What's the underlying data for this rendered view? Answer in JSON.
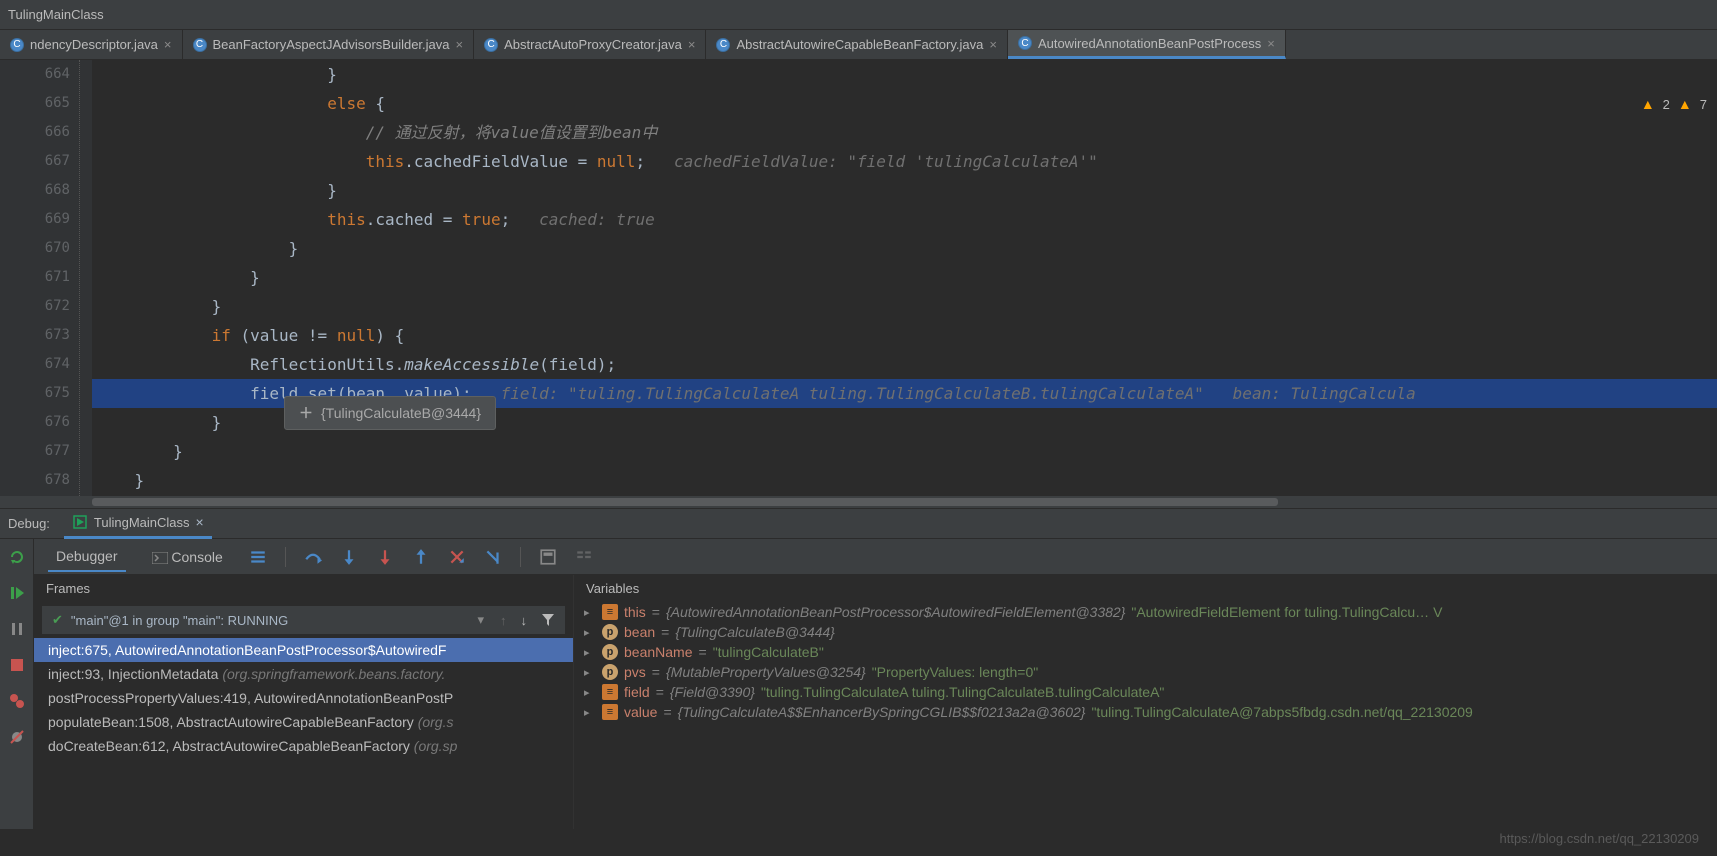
{
  "topbar": {
    "run_config": "TulingMainClass"
  },
  "tabs": [
    {
      "label": "ndencyDescriptor.java",
      "active": false
    },
    {
      "label": "BeanFactoryAspectJAdvisorsBuilder.java",
      "active": false
    },
    {
      "label": "AbstractAutoProxyCreator.java",
      "active": false
    },
    {
      "label": "AbstractAutowireCapableBeanFactory.java",
      "active": false
    },
    {
      "label": "AutowiredAnnotationBeanPostProcess",
      "active": true
    }
  ],
  "warnings": {
    "count1": "2",
    "count2": "7"
  },
  "editor": {
    "lines": [
      {
        "n": "664",
        "indent": 24,
        "html": "}"
      },
      {
        "n": "665",
        "indent": 24,
        "html": "<span class='kw'>else</span> {"
      },
      {
        "n": "666",
        "indent": 28,
        "html": "<span class='cmt'>// 通过反射，将value值设置到bean中</span>"
      },
      {
        "n": "667",
        "indent": 28,
        "html": "<span class='kw'>this</span>.cachedFieldValue = <span class='kw'>null</span>;   <span class='inlinehint'>cachedFieldValue: \"field 'tulingCalculateA'\"</span>"
      },
      {
        "n": "668",
        "indent": 24,
        "html": "}"
      },
      {
        "n": "669",
        "indent": 24,
        "html": "<span class='kw'>this</span>.cached = <span class='kw'>true</span>;   <span class='inlinehint'>cached: true</span>"
      },
      {
        "n": "670",
        "indent": 20,
        "html": "}"
      },
      {
        "n": "671",
        "indent": 16,
        "html": "}"
      },
      {
        "n": "672",
        "indent": 12,
        "html": "}"
      },
      {
        "n": "673",
        "indent": 12,
        "html": "<span class='kw'>if</span> (value != <span class='kw'>null</span>) {"
      },
      {
        "n": "674",
        "indent": 16,
        "html": "ReflectionUtils.<span class='it'>makeAccessible</span>(field);"
      },
      {
        "n": "675",
        "indent": 16,
        "html": "field.set(bean, value);   <span class='inlinehint'>field: \"tuling.TulingCalculateA tuling.TulingCalculateB.tulingCalculateA\"   bean: TulingCalcula</span>",
        "current": true
      },
      {
        "n": "676",
        "indent": 12,
        "html": "}"
      },
      {
        "n": "677",
        "indent": 8,
        "html": "}"
      },
      {
        "n": "678",
        "indent": 4,
        "html": "}"
      }
    ],
    "tooltip": "{TulingCalculateB@3444}"
  },
  "debug": {
    "label": "Debug:",
    "config": "TulingMainClass",
    "tab_debugger": "Debugger",
    "tab_console": "Console",
    "frames_title": "Frames",
    "variables_title": "Variables",
    "thread": "\"main\"@1 in group \"main\": RUNNING",
    "frames": [
      {
        "text": "inject:675, AutowiredAnnotationBeanPostProcessor$AutowiredF",
        "pkg": "",
        "selected": true
      },
      {
        "text": "inject:93, InjectionMetadata ",
        "pkg": "(org.springframework.beans.factory.",
        "selected": false
      },
      {
        "text": "postProcessPropertyValues:419, AutowiredAnnotationBeanPostP",
        "pkg": "",
        "selected": false
      },
      {
        "text": "populateBean:1508, AbstractAutowireCapableBeanFactory ",
        "pkg": "(org.s",
        "selected": false
      },
      {
        "text": "doCreateBean:612, AbstractAutowireCapableBeanFactory ",
        "pkg": "(org.sp",
        "selected": false
      }
    ],
    "vars": [
      {
        "badge": "eq",
        "name": "this",
        "obj": "{AutowiredAnnotationBeanPostProcessor$AutowiredFieldElement@3382}",
        "str": "\"AutowiredFieldElement for tuling.TulingCalcu… V"
      },
      {
        "badge": "p",
        "name": "bean",
        "obj": "{TulingCalculateB@3444}",
        "str": ""
      },
      {
        "badge": "p",
        "name": "beanName",
        "obj": "",
        "str": "\"tulingCalculateB\""
      },
      {
        "badge": "p",
        "name": "pvs",
        "obj": "{MutablePropertyValues@3254}",
        "str": "\"PropertyValues: length=0\""
      },
      {
        "badge": "eq",
        "name": "field",
        "obj": "{Field@3390}",
        "str": "\"tuling.TulingCalculateA tuling.TulingCalculateB.tulingCalculateA\""
      },
      {
        "badge": "eq",
        "name": "value",
        "obj": "{TulingCalculateA$$EnhancerBySpringCGLIB$$f0213a2a@3602}",
        "str": "\"tuling.TulingCalculateA@7abps5fbdg.csdn.net/qq_22130209"
      }
    ]
  },
  "watermark": "https://blog.csdn.net/qq_22130209"
}
